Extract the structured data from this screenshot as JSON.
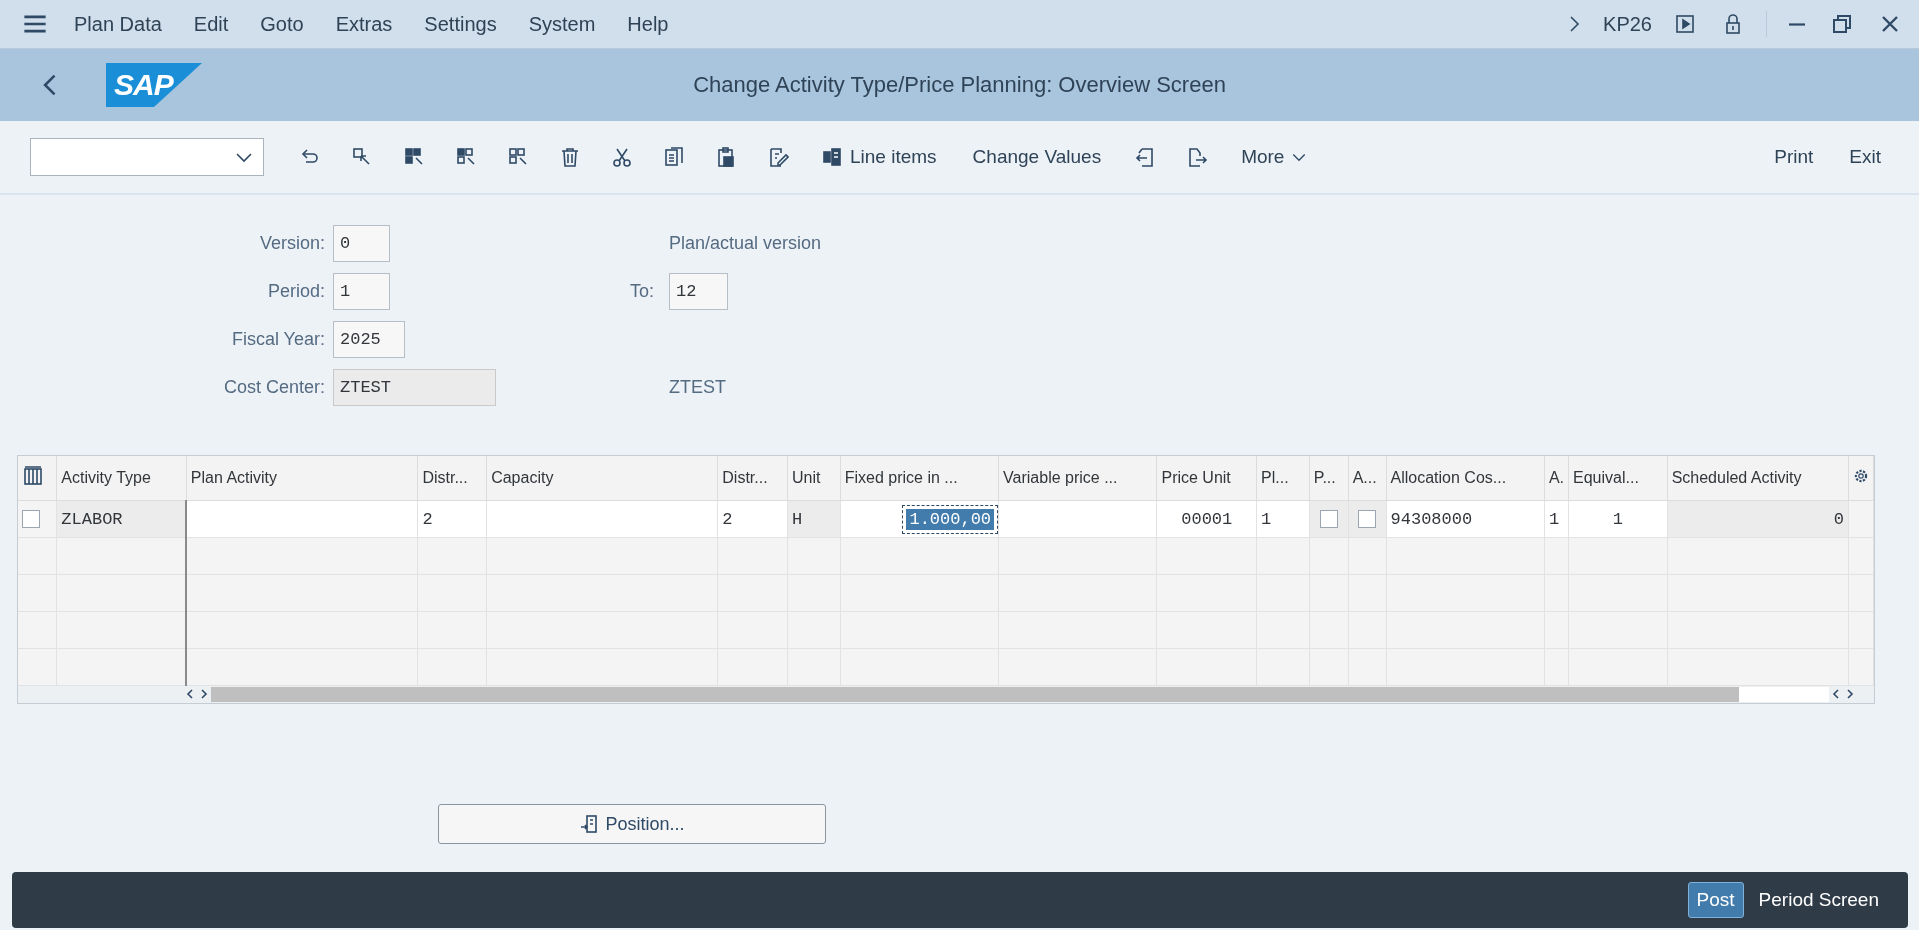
{
  "menu_bar": {
    "items": [
      "Plan Data",
      "Edit",
      "Goto",
      "Extras",
      "Settings",
      "System",
      "Help"
    ],
    "transaction": "KP26"
  },
  "title_bar": {
    "logo": "SAP",
    "title": "Change Activity Type/Price Planning: Overview Screen"
  },
  "toolbar": {
    "line_items": "Line items",
    "change_values": "Change Values",
    "more": "More",
    "right_buttons": [
      "Print",
      "Exit"
    ]
  },
  "form": {
    "fields": [
      {
        "label": "Version:",
        "value": "0",
        "description": "Plan/actual version",
        "readonly": false
      },
      {
        "label": "Period:",
        "value": "1",
        "to_label": "To:",
        "to_value": "12",
        "readonly": false
      },
      {
        "label": "Fiscal Year:",
        "value": "2025",
        "readonly": false
      },
      {
        "label": "Cost Center:",
        "value": "ZTEST",
        "description": "ZTEST",
        "readonly": true
      }
    ]
  },
  "table": {
    "columns": [
      "Activity Type",
      "Plan Activity",
      "Distr...",
      "Capacity",
      "Distr...",
      "Unit",
      "Fixed price in ...",
      "Variable price ...",
      "Price Unit",
      "Pl...",
      "P...",
      "A...",
      "Allocation Cos...",
      "A.",
      "Equival...",
      "Scheduled Activity"
    ],
    "rows": [
      {
        "selected": false,
        "cells": [
          {
            "kind": "readonly",
            "text": "ZLABOR"
          },
          {
            "kind": "input"
          },
          {
            "kind": "input",
            "text": "2"
          },
          {
            "kind": "input"
          },
          {
            "kind": "input",
            "text": "2"
          },
          {
            "kind": "readonly",
            "text": "H"
          },
          {
            "kind": "focused",
            "text": "1.000,00"
          },
          {
            "kind": "input"
          },
          {
            "kind": "input",
            "text": "00001"
          },
          {
            "kind": "input",
            "text": "1"
          },
          {
            "kind": "checkbox",
            "checked": false
          },
          {
            "kind": "checkbox",
            "checked": false
          },
          {
            "kind": "input",
            "text": "94308000"
          },
          {
            "kind": "input",
            "text": "1"
          },
          {
            "kind": "input",
            "text": "1"
          },
          {
            "kind": "readonly",
            "text": "0"
          }
        ]
      }
    ]
  },
  "position_button": "Position...",
  "footer": {
    "buttons": [
      {
        "label": "Post",
        "kind": "primary"
      },
      {
        "label": "Period Screen",
        "kind": "plain"
      }
    ]
  }
}
